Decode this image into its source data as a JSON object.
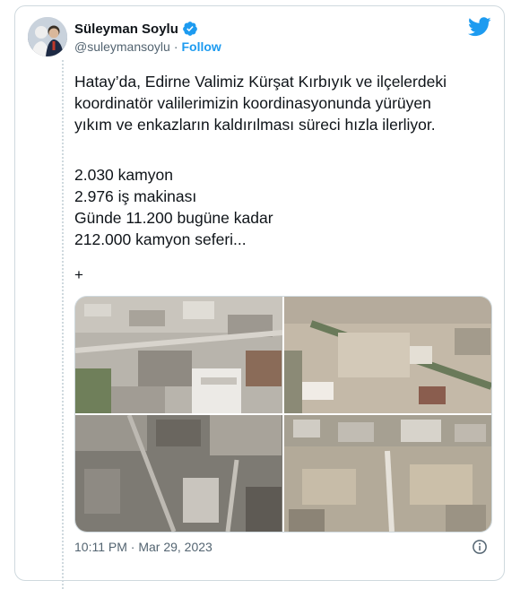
{
  "author": {
    "name": "Süleyman Soylu",
    "handle": "@suleymansoylu",
    "separator": "·",
    "follow_label": "Follow"
  },
  "tweet": {
    "text": "Hatay’da, Edirne Valimiz Kürşat Kırbıyık ve ilçelerdeki\nkoordinatör valilerimizin koordinasyonunda yürüyen\nyıkım ve enkazların kaldırılması süreci hızla ilerliyor.",
    "stats": [
      "2.030 kamyon",
      "2.976 iş makinası",
      "Günde 11.200 bugüne kadar",
      "212.000 kamyon seferi..."
    ],
    "plus": "+"
  },
  "footer": {
    "timestamp": "10:11 PM · Mar 29, 2023"
  },
  "colors": {
    "accent": "#1d9bf0",
    "text": "#0f1419",
    "muted": "#536471",
    "border": "#cfd9de"
  },
  "icons": {
    "verified": "verified-badge-icon",
    "brand": "twitter-bird-icon",
    "info": "info-icon"
  }
}
